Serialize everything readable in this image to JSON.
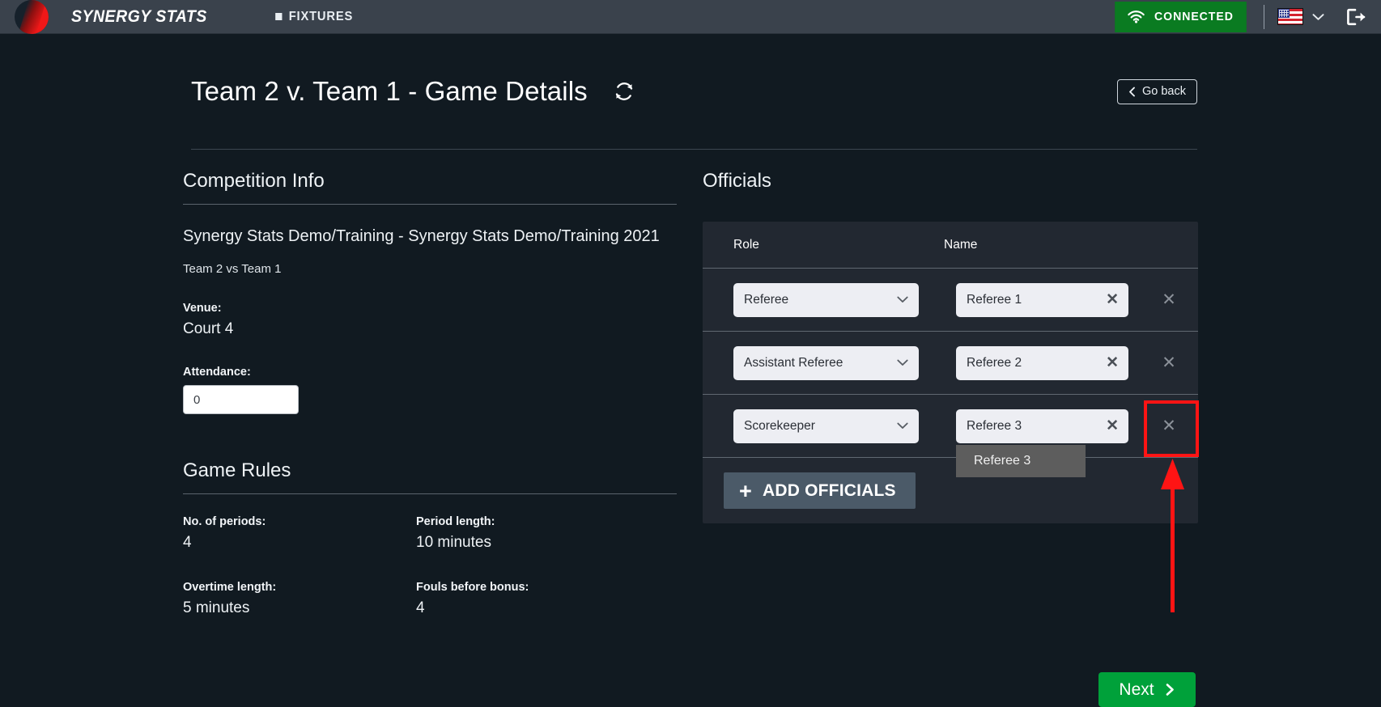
{
  "topbar": {
    "brand": "SYNERGY STATS",
    "nav": [
      {
        "label": "FIXTURES",
        "icon": "square-bullet-icon"
      }
    ],
    "connection_label": "CONNECTED",
    "connection_color": "#0a7b21",
    "wifi_icon": "wifi-icon",
    "language_icon": "us-flag-icon",
    "language_chevron_icon": "chevron-down-icon",
    "logout_icon": "logout-icon"
  },
  "header": {
    "title": "Team 2 v. Team 1 - Game Details",
    "refresh_icon": "refresh-icon",
    "go_back_label": "Go back",
    "go_back_icon": "chevron-left-icon"
  },
  "competition": {
    "section_title": "Competition Info",
    "name": "Synergy Stats Demo/Training - Synergy Stats Demo/Training 2021",
    "matchup": "Team 2 vs Team 1",
    "venue_label": "Venue:",
    "venue_value": "Court 4",
    "attendance_label": "Attendance:",
    "attendance_value": "0",
    "attendance_placeholder": "0"
  },
  "game_rules": {
    "section_title": "Game Rules",
    "fields": [
      {
        "label": "No. of periods:",
        "value": "4"
      },
      {
        "label": "Period length:",
        "value": "10 minutes"
      },
      {
        "label": "Overtime length:",
        "value": "5 minutes"
      },
      {
        "label": "Fouls before bonus:",
        "value": "4"
      }
    ]
  },
  "officials": {
    "section_title": "Officials",
    "columns": {
      "role": "Role",
      "name": "Name"
    },
    "rows": [
      {
        "role": "Referee",
        "name": "Referee 1",
        "clear_icon": "close-icon",
        "delete_icon": "close-icon"
      },
      {
        "role": "Assistant Referee",
        "name": "Referee 2",
        "clear_icon": "close-icon",
        "delete_icon": "close-icon"
      },
      {
        "role": "Scorekeeper",
        "name": "Referee 3",
        "clear_icon": "close-icon",
        "delete_icon": "close-icon"
      }
    ],
    "autocomplete_suggestion": "Referee 3",
    "add_button_label": "ADD OFFICIALS",
    "add_button_icon": "plus-icon",
    "role_options": [
      "Referee",
      "Assistant Referee",
      "Scorekeeper"
    ],
    "dropdown_icon": "chevron-down-icon"
  },
  "footer": {
    "next_label": "Next",
    "next_icon": "chevron-right-icon",
    "next_color": "#00a13a"
  },
  "annotation": {
    "highlight_color": "#ff1414",
    "target": "delete-official-row-3"
  }
}
